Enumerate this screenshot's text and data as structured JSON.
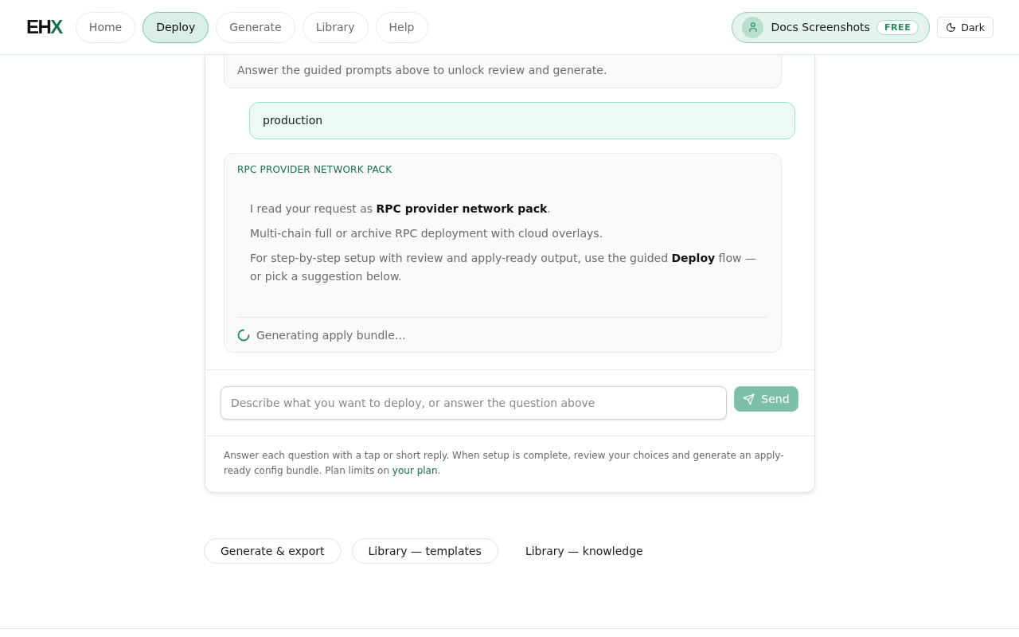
{
  "header": {
    "logo": {
      "text": "EH",
      "accent": "X"
    },
    "nav": [
      {
        "label": "Home",
        "selected": false
      },
      {
        "label": "Deploy",
        "selected": true
      },
      {
        "label": "Generate",
        "selected": false
      },
      {
        "label": "Library",
        "selected": false
      },
      {
        "label": "Help",
        "selected": false
      }
    ],
    "account": {
      "name": "Docs Screenshots",
      "plan": "FREE"
    },
    "theme_toggle": {
      "label": "Dark"
    }
  },
  "chat": {
    "messages": [
      {
        "kind": "note",
        "text": "Answer the guided prompts above to unlock review and generate."
      },
      {
        "kind": "user",
        "text": "production"
      },
      {
        "kind": "reply",
        "title": "RPC PROVIDER NETWORK PACK",
        "paragraphs": [
          "I read your request as **RPC provider network pack**.",
          "Multi-chain full or archive RPC deployment with cloud overlays.",
          "For step-by-step setup with review and apply-ready output, use the guided **Deploy** flow — or pick a suggestion below."
        ],
        "status": "Generating apply bundle…"
      }
    ]
  },
  "composer": {
    "placeholder": "Describe what you want to deploy, or answer the question above",
    "send_button": {
      "label": "Send",
      "disabled": true
    }
  },
  "help_note": {
    "text": "Answer each question with a tap or short reply. When setup is complete, review your choices and generate an apply-ready config bundle. Plan limits on",
    "link": "your plan",
    "after": "."
  },
  "suggestions": [
    {
      "label": "Generate & export",
      "kind": "pill"
    },
    {
      "label": "Library — templates",
      "kind": "pill"
    },
    {
      "label": "Library — knowledge",
      "kind": "plain"
    }
  ]
}
